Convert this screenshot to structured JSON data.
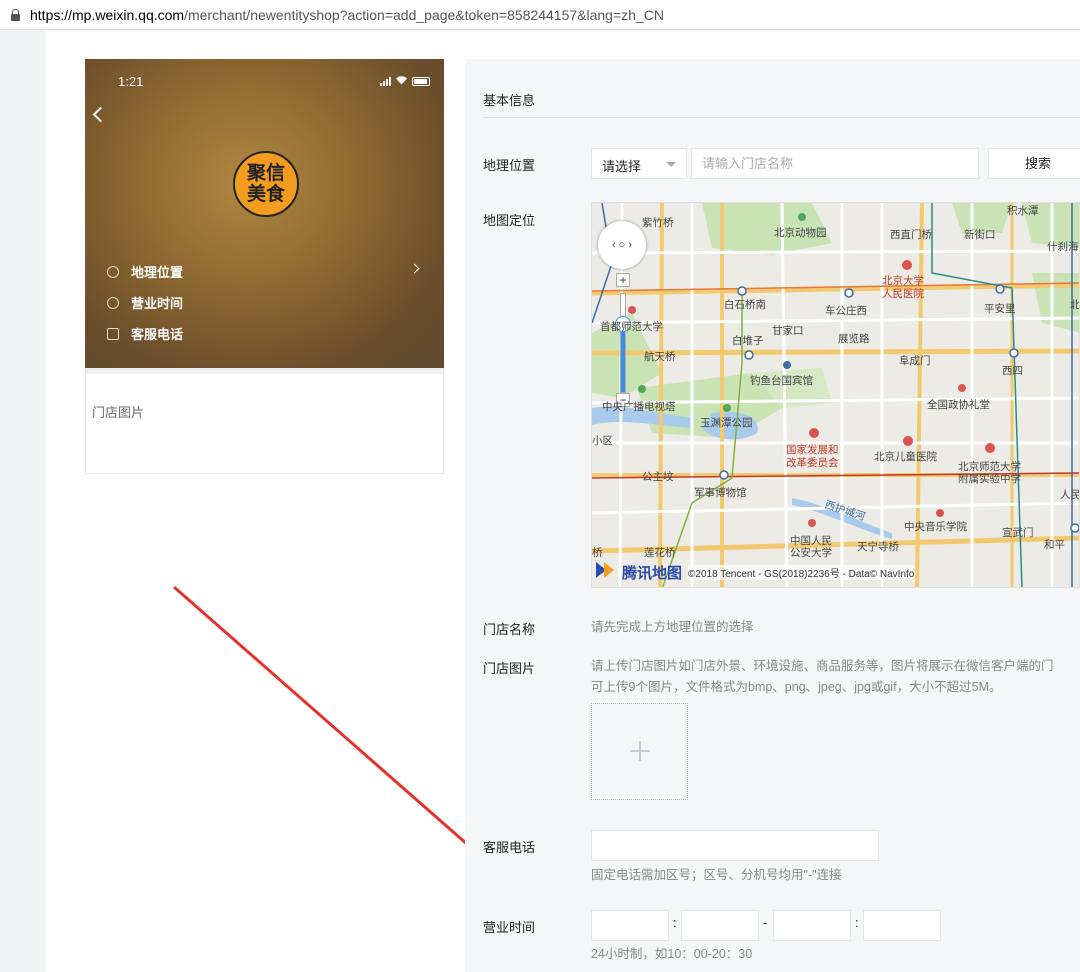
{
  "browser": {
    "url_host": "https://mp.weixin.qq.com",
    "url_rest": "/merchant/newentityshop?action=add_page&token=858244157&lang=zh_CN"
  },
  "preview": {
    "time": "1:21",
    "logo_line1": "聚信",
    "logo_line2": "美食",
    "menu": [
      "地理位置",
      "营业时间",
      "客服电话"
    ],
    "photo_label": "门店图片"
  },
  "form": {
    "section_title": "基本信息",
    "location_label": "地理位置",
    "select_value": "请选择",
    "name_placeholder": "请输入门店名称",
    "search_label": "搜索",
    "map_label": "地图定位",
    "store_name_label": "门店名称",
    "store_name_hint": "请先完成上方地理位置的选择",
    "photo_label": "门店图片",
    "photo_hint_1": "请上传门店图片如门店外景、环境设施、商品服务等，图片将展示在微信客户端的门",
    "photo_hint_2": "可上传9个图片，文件格式为bmp、png、jpeg、jpg或gif，大小不超过5M。",
    "tel_label": "客服电话",
    "tel_hint": "固定电话需加区号；区号、分机号均用\"-\"连接",
    "hours_label": "营业时间",
    "hours_colon": ":",
    "hours_dash": "-",
    "hours_hint": "24小时制，如10：00-20：30"
  },
  "map": {
    "brand": "腾讯地图",
    "copyright": "©2018 Tencent - GS(2018)2236号 - Data© NavInfo",
    "labels": [
      {
        "text": "紫竹桥",
        "kind": "normal"
      },
      {
        "text": "北京动物园",
        "kind": "normal"
      },
      {
        "text": "西直门桥",
        "kind": "normal"
      },
      {
        "text": "新街口",
        "kind": "normal"
      },
      {
        "text": "积水潭",
        "kind": "normal"
      },
      {
        "text": "什刹海",
        "kind": "normal"
      },
      {
        "text": "北京大学",
        "kind": "red"
      },
      {
        "text": "人民医院",
        "kind": "red"
      },
      {
        "text": "白石桥南",
        "kind": "normal"
      },
      {
        "text": "车公庄西",
        "kind": "normal"
      },
      {
        "text": "平安里",
        "kind": "normal"
      },
      {
        "text": "北",
        "kind": "normal"
      },
      {
        "text": "首都师范大学",
        "kind": "normal"
      },
      {
        "text": "甘家口",
        "kind": "normal"
      },
      {
        "text": "白堆子",
        "kind": "normal"
      },
      {
        "text": "展览路",
        "kind": "normal"
      },
      {
        "text": "航天桥",
        "kind": "normal"
      },
      {
        "text": "阜成门",
        "kind": "normal"
      },
      {
        "text": "西四",
        "kind": "normal"
      },
      {
        "text": "钓鱼台国宾馆",
        "kind": "normal"
      },
      {
        "text": "中央广播电视塔",
        "kind": "normal"
      },
      {
        "text": "全国政协礼堂",
        "kind": "normal"
      },
      {
        "text": "玉渊潭公园",
        "kind": "normal"
      },
      {
        "text": "小区",
        "kind": "normal"
      },
      {
        "text": "国家发展和",
        "kind": "red"
      },
      {
        "text": "改革委员会",
        "kind": "red"
      },
      {
        "text": "北京儿童医院",
        "kind": "normal"
      },
      {
        "text": "北京师范大学",
        "kind": "normal"
      },
      {
        "text": "附属实验中学",
        "kind": "normal"
      },
      {
        "text": "公主坟",
        "kind": "normal"
      },
      {
        "text": "军事博物馆",
        "kind": "normal"
      },
      {
        "text": "人民",
        "kind": "normal"
      },
      {
        "text": "西护城河",
        "kind": "blue"
      },
      {
        "text": "中央音乐学院",
        "kind": "normal"
      },
      {
        "text": "宣武门",
        "kind": "normal"
      },
      {
        "text": "中国人民",
        "kind": "normal"
      },
      {
        "text": "公安大学",
        "kind": "normal"
      },
      {
        "text": "天宁寺桥",
        "kind": "normal"
      },
      {
        "text": "和平",
        "kind": "normal"
      },
      {
        "text": "莲花桥",
        "kind": "normal"
      },
      {
        "text": "桥",
        "kind": "normal"
      }
    ]
  }
}
